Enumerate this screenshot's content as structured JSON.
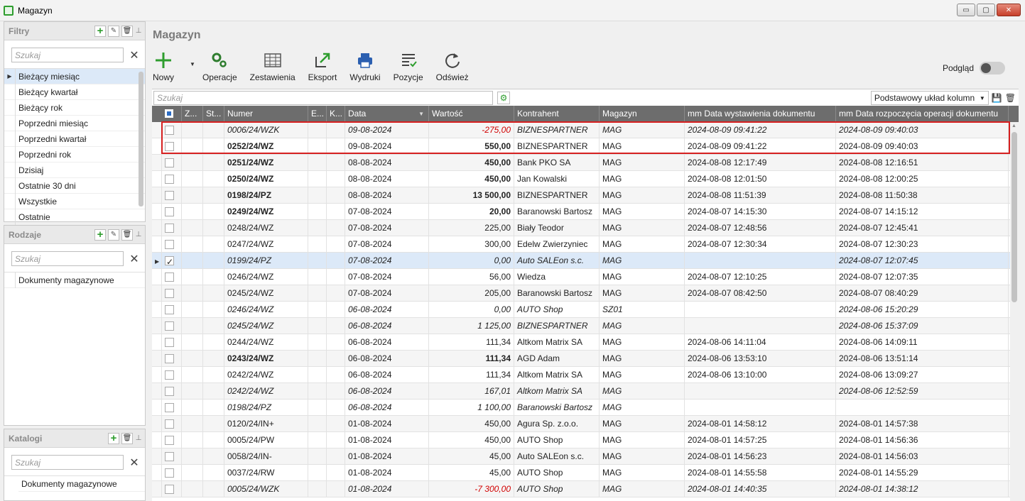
{
  "window": {
    "title": "Magazyn",
    "min": "▭",
    "max": "▢",
    "close": "✕"
  },
  "filters": {
    "title": "Filtry",
    "search_placeholder": "Szukaj",
    "items": [
      "Bieżący miesiąc",
      "Bieżący kwartał",
      "Bieżący rok",
      "Poprzedni miesiąc",
      "Poprzedni kwartał",
      "Poprzedni rok",
      "Dzisiaj",
      "Ostatnie 30 dni",
      "Wszystkie",
      "Ostatnie"
    ]
  },
  "kinds": {
    "title": "Rodzaje",
    "search_placeholder": "Szukaj",
    "items": [
      "Dokumenty magazynowe"
    ]
  },
  "catalogs": {
    "title": "Katalogi",
    "search_placeholder": "Szukaj",
    "items": [
      "Dokumenty magazynowe"
    ]
  },
  "main": {
    "title": "Magazyn",
    "toolbar": {
      "new": "Nowy",
      "operations": "Operacje",
      "statements": "Zestawienia",
      "export": "Eksport",
      "prints": "Wydruki",
      "positions": "Pozycje",
      "refresh": "Odśwież"
    },
    "preview_label": "Podgląd",
    "search_placeholder": "Szukaj",
    "layout": "Podstawowy układ kolumn"
  },
  "grid": {
    "headers": [
      "Z...",
      "St...",
      "Numer",
      "E...",
      "K...",
      "Data",
      "Wartość",
      "Kontrahent",
      "Magazyn",
      "mm Data wystawienia dokumentu",
      "mm Data rozpoczęcia operacji dokumentu"
    ],
    "rows": [
      {
        "num": "0006/24/WZK",
        "date": "09-08-2024",
        "val": "-275,00",
        "contr": "BIZNESPARTNER",
        "mag": "MAG",
        "issued": "2024-08-09 09:41:22",
        "started": "2024-08-09 09:40:03",
        "style": "it",
        "neg": true
      },
      {
        "num": "0252/24/WZ",
        "date": "09-08-2024",
        "val": "550,00",
        "contr": "BIZNESPARTNER",
        "mag": "MAG",
        "issued": "2024-08-09 09:41:22",
        "started": "2024-08-09 09:40:03",
        "style": "b"
      },
      {
        "num": "0251/24/WZ",
        "date": "08-08-2024",
        "val": "450,00",
        "contr": "Bank PKO SA",
        "mag": "MAG",
        "issued": "2024-08-08 12:17:49",
        "started": "2024-08-08 12:16:51",
        "style": "b"
      },
      {
        "num": "0250/24/WZ",
        "date": "08-08-2024",
        "val": "450,00",
        "contr": "Jan Kowalski",
        "mag": "MAG",
        "issued": "2024-08-08 12:01:50",
        "started": "2024-08-08 12:00:25",
        "style": "b"
      },
      {
        "num": "0198/24/PZ",
        "date": "08-08-2024",
        "val": "13 500,00",
        "contr": "BIZNESPARTNER",
        "mag": "MAG",
        "issued": "2024-08-08 11:51:39",
        "started": "2024-08-08 11:50:38",
        "style": "b"
      },
      {
        "num": "0249/24/WZ",
        "date": "07-08-2024",
        "val": "20,00",
        "contr": "Baranowski Bartosz",
        "mag": "MAG",
        "issued": "2024-08-07 14:15:30",
        "started": "2024-08-07 14:15:12",
        "style": "b"
      },
      {
        "num": "0248/24/WZ",
        "date": "07-08-2024",
        "val": "225,00",
        "contr": "Biały Teodor",
        "mag": "MAG",
        "issued": "2024-08-07 12:48:56",
        "started": "2024-08-07 12:45:41",
        "style": ""
      },
      {
        "num": "0247/24/WZ",
        "date": "07-08-2024",
        "val": "300,00",
        "contr": "Edelw Zwierzyniec",
        "mag": "MAG",
        "issued": "2024-08-07 12:30:34",
        "started": "2024-08-07 12:30:23",
        "style": ""
      },
      {
        "num": "0199/24/PZ",
        "date": "07-08-2024",
        "val": "0,00",
        "contr": "Auto SALEon s.c.",
        "mag": "MAG",
        "issued": "",
        "started": "2024-08-07 12:07:45",
        "style": "it",
        "selected": true
      },
      {
        "num": "0246/24/WZ",
        "date": "07-08-2024",
        "val": "56,00",
        "contr": "Wiedza",
        "mag": "MAG",
        "issued": "2024-08-07 12:10:25",
        "started": "2024-08-07 12:07:35",
        "style": ""
      },
      {
        "num": "0245/24/WZ",
        "date": "07-08-2024",
        "val": "205,00",
        "contr": "Baranowski Bartosz",
        "mag": "MAG",
        "issued": "2024-08-07 08:42:50",
        "started": "2024-08-07 08:40:29",
        "style": ""
      },
      {
        "num": "0246/24/WZ",
        "date": "06-08-2024",
        "val": "0,00",
        "contr": "AUTO Shop",
        "mag": "SZ01",
        "issued": "",
        "started": "2024-08-06 15:20:29",
        "style": "it"
      },
      {
        "num": "0245/24/WZ",
        "date": "06-08-2024",
        "val": "1 125,00",
        "contr": "BIZNESPARTNER",
        "mag": "MAG",
        "issued": "",
        "started": "2024-08-06 15:37:09",
        "style": "it"
      },
      {
        "num": "0244/24/WZ",
        "date": "06-08-2024",
        "val": "111,34",
        "contr": "Altkom Matrix SA",
        "mag": "MAG",
        "issued": "2024-08-06 14:11:04",
        "started": "2024-08-06 14:09:11",
        "style": ""
      },
      {
        "num": "0243/24/WZ",
        "date": "06-08-2024",
        "val": "111,34",
        "contr": "AGD Adam",
        "mag": "MAG",
        "issued": "2024-08-06 13:53:10",
        "started": "2024-08-06 13:51:14",
        "style": "b"
      },
      {
        "num": "0242/24/WZ",
        "date": "06-08-2024",
        "val": "111,34",
        "contr": "Altkom Matrix SA",
        "mag": "MAG",
        "issued": "2024-08-06 13:10:00",
        "started": "2024-08-06 13:09:27",
        "style": ""
      },
      {
        "num": "0242/24/WZ",
        "date": "06-08-2024",
        "val": "167,01",
        "contr": "Altkom Matrix SA",
        "mag": "MAG",
        "issued": "",
        "started": "2024-08-06 12:52:59",
        "style": "it"
      },
      {
        "num": "0198/24/PZ",
        "date": "06-08-2024",
        "val": "1 100,00",
        "contr": "Baranowski Bartosz",
        "mag": "MAG",
        "issued": "",
        "started": "",
        "style": "it"
      },
      {
        "num": "0120/24/IN+",
        "date": "01-08-2024",
        "val": "450,00",
        "contr": "Agura Sp. z.o.o.",
        "mag": "MAG",
        "issued": "2024-08-01 14:58:12",
        "started": "2024-08-01 14:57:38",
        "style": ""
      },
      {
        "num": "0005/24/PW",
        "date": "01-08-2024",
        "val": "450,00",
        "contr": "AUTO Shop",
        "mag": "MAG",
        "issued": "2024-08-01 14:57:25",
        "started": "2024-08-01 14:56:36",
        "style": ""
      },
      {
        "num": "0058/24/IN-",
        "date": "01-08-2024",
        "val": "45,00",
        "contr": "Auto SALEon s.c.",
        "mag": "MAG",
        "issued": "2024-08-01 14:56:23",
        "started": "2024-08-01 14:56:03",
        "style": ""
      },
      {
        "num": "0037/24/RW",
        "date": "01-08-2024",
        "val": "45,00",
        "contr": "AUTO Shop",
        "mag": "MAG",
        "issued": "2024-08-01 14:55:58",
        "started": "2024-08-01 14:55:29",
        "style": ""
      },
      {
        "num": "0005/24/WZK",
        "date": "01-08-2024",
        "val": "-7 300,00",
        "contr": "AUTO Shop",
        "mag": "MAG",
        "issued": "2024-08-01 14:40:35",
        "started": "2024-08-01 14:38:12",
        "style": "it",
        "neg": true
      }
    ]
  },
  "colors": {
    "accent_green": "#2e9d2e",
    "header_gray": "#6d6d6d",
    "selected_row": "#dce9f8",
    "negative": "#d10000",
    "highlight": "#d62020"
  },
  "icons": [
    "plus-icon",
    "gears-icon",
    "table-icon",
    "export-icon",
    "printer-icon",
    "list-check-icon",
    "refresh-icon"
  ]
}
